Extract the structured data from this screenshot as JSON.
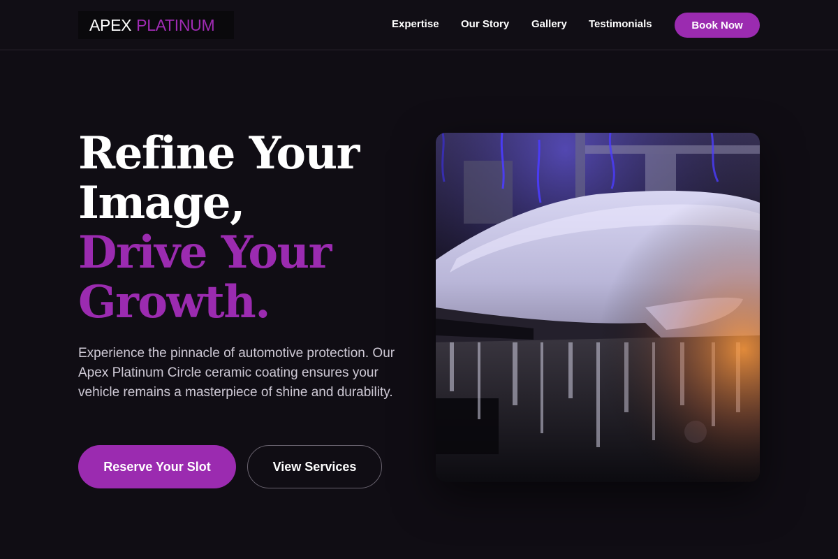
{
  "header": {
    "logo": {
      "brand": "APEX",
      "accent": "PLATINUM"
    },
    "nav": [
      {
        "label": "Expertise"
      },
      {
        "label": "Our Story"
      },
      {
        "label": "Gallery"
      },
      {
        "label": "Testimonials"
      }
    ],
    "cta_label": "Book Now"
  },
  "hero": {
    "headline": {
      "line1": "Refine Your",
      "line2": "Image,",
      "line3": "Drive Your",
      "line4": "Growth."
    },
    "lead": "Experience the pinnacle of automotive protection. Our Apex Platinum Circle ceramic coating ensures your vehicle remains a masterpiece of shine and durability.",
    "primary_cta": "Reserve Your Slot",
    "secondary_cta": "View Services",
    "image_alt": "car-covered-in-snow-foam"
  },
  "colors": {
    "background": "#100d14",
    "accent": "#9b2bb0",
    "text": "#ffffff",
    "muted_text": "#cfcad6"
  }
}
